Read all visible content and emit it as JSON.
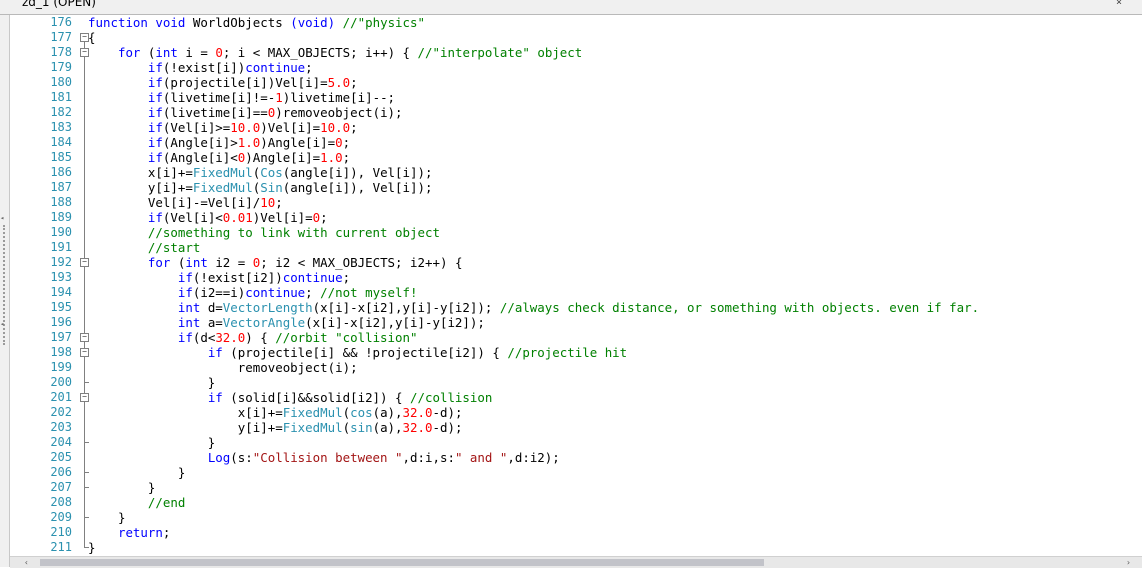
{
  "tab": {
    "title": "zd_1 (OPEN)",
    "close_label": "×"
  },
  "editor": {
    "lines": [
      {
        "num": "176",
        "fold": "none",
        "tokens": [
          {
            "t": "function void",
            "c": "kw"
          },
          {
            "t": " WorldObjects ",
            "c": ""
          },
          {
            "t": "(void)",
            "c": "kw"
          },
          {
            "t": " ",
            "c": ""
          },
          {
            "t": "//\"physics\"",
            "c": "cm"
          }
        ]
      },
      {
        "num": "177",
        "fold": "open",
        "tokens": [
          {
            "t": "{",
            "c": ""
          }
        ]
      },
      {
        "num": "178",
        "fold": "open",
        "tokens": [
          {
            "t": "    ",
            "c": ""
          },
          {
            "t": "for",
            "c": "kw"
          },
          {
            "t": " (",
            "c": ""
          },
          {
            "t": "int",
            "c": "kw"
          },
          {
            "t": " i = ",
            "c": ""
          },
          {
            "t": "0",
            "c": "num"
          },
          {
            "t": "; i < MAX_OBJECTS; i++) { ",
            "c": ""
          },
          {
            "t": "//\"interpolate\" object",
            "c": "cm"
          }
        ]
      },
      {
        "num": "179",
        "fold": "line",
        "tokens": [
          {
            "t": "        ",
            "c": ""
          },
          {
            "t": "if",
            "c": "kw"
          },
          {
            "t": "(!exist[i])",
            "c": ""
          },
          {
            "t": "continue",
            "c": "kw"
          },
          {
            "t": ";",
            "c": ""
          }
        ]
      },
      {
        "num": "180",
        "fold": "line",
        "tokens": [
          {
            "t": "        ",
            "c": ""
          },
          {
            "t": "if",
            "c": "kw"
          },
          {
            "t": "(projectile[i])Vel[i]=",
            "c": ""
          },
          {
            "t": "5.0",
            "c": "num"
          },
          {
            "t": ";",
            "c": ""
          }
        ]
      },
      {
        "num": "181",
        "fold": "line",
        "tokens": [
          {
            "t": "        ",
            "c": ""
          },
          {
            "t": "if",
            "c": "kw"
          },
          {
            "t": "(livetime[i]!=-",
            "c": ""
          },
          {
            "t": "1",
            "c": "num"
          },
          {
            "t": ")livetime[i]--;",
            "c": ""
          }
        ]
      },
      {
        "num": "182",
        "fold": "line",
        "tokens": [
          {
            "t": "        ",
            "c": ""
          },
          {
            "t": "if",
            "c": "kw"
          },
          {
            "t": "(livetime[i]==",
            "c": ""
          },
          {
            "t": "0",
            "c": "num"
          },
          {
            "t": ")removeobject(i);",
            "c": ""
          }
        ]
      },
      {
        "num": "183",
        "fold": "line",
        "tokens": [
          {
            "t": "        ",
            "c": ""
          },
          {
            "t": "if",
            "c": "kw"
          },
          {
            "t": "(Vel[i]>=",
            "c": ""
          },
          {
            "t": "10.0",
            "c": "num"
          },
          {
            "t": ")Vel[i]=",
            "c": ""
          },
          {
            "t": "10.0",
            "c": "num"
          },
          {
            "t": ";",
            "c": ""
          }
        ]
      },
      {
        "num": "184",
        "fold": "line",
        "tokens": [
          {
            "t": "        ",
            "c": ""
          },
          {
            "t": "if",
            "c": "kw"
          },
          {
            "t": "(Angle[i]>",
            "c": ""
          },
          {
            "t": "1.0",
            "c": "num"
          },
          {
            "t": ")Angle[i]=",
            "c": ""
          },
          {
            "t": "0",
            "c": "num"
          },
          {
            "t": ";",
            "c": ""
          }
        ]
      },
      {
        "num": "185",
        "fold": "line",
        "tokens": [
          {
            "t": "        ",
            "c": ""
          },
          {
            "t": "if",
            "c": "kw"
          },
          {
            "t": "(Angle[i]<",
            "c": ""
          },
          {
            "t": "0",
            "c": "num"
          },
          {
            "t": ")Angle[i]=",
            "c": ""
          },
          {
            "t": "1.0",
            "c": "num"
          },
          {
            "t": ";",
            "c": ""
          }
        ]
      },
      {
        "num": "186",
        "fold": "line",
        "tokens": [
          {
            "t": "        x[i]+=",
            "c": ""
          },
          {
            "t": "FixedMul",
            "c": "fn"
          },
          {
            "t": "(",
            "c": ""
          },
          {
            "t": "Cos",
            "c": "fn"
          },
          {
            "t": "(angle[i]), Vel[i]);",
            "c": ""
          }
        ]
      },
      {
        "num": "187",
        "fold": "line",
        "tokens": [
          {
            "t": "        y[i]+=",
            "c": ""
          },
          {
            "t": "FixedMul",
            "c": "fn"
          },
          {
            "t": "(",
            "c": ""
          },
          {
            "t": "Sin",
            "c": "fn"
          },
          {
            "t": "(angle[i]), Vel[i]);",
            "c": ""
          }
        ]
      },
      {
        "num": "188",
        "fold": "line",
        "tokens": [
          {
            "t": "        Vel[i]-=Vel[i]/",
            "c": ""
          },
          {
            "t": "10",
            "c": "num"
          },
          {
            "t": ";",
            "c": ""
          }
        ]
      },
      {
        "num": "189",
        "fold": "line",
        "tokens": [
          {
            "t": "        ",
            "c": ""
          },
          {
            "t": "if",
            "c": "kw"
          },
          {
            "t": "(Vel[i]<",
            "c": ""
          },
          {
            "t": "0.01",
            "c": "num"
          },
          {
            "t": ")Vel[i]=",
            "c": ""
          },
          {
            "t": "0",
            "c": "num"
          },
          {
            "t": ";",
            "c": ""
          }
        ]
      },
      {
        "num": "190",
        "fold": "line",
        "tokens": [
          {
            "t": "        ",
            "c": ""
          },
          {
            "t": "//something to link with current object",
            "c": "cm"
          }
        ]
      },
      {
        "num": "191",
        "fold": "line",
        "tokens": [
          {
            "t": "        ",
            "c": ""
          },
          {
            "t": "//start",
            "c": "cm"
          }
        ]
      },
      {
        "num": "192",
        "fold": "open",
        "tokens": [
          {
            "t": "        ",
            "c": ""
          },
          {
            "t": "for",
            "c": "kw"
          },
          {
            "t": " (",
            "c": ""
          },
          {
            "t": "int",
            "c": "kw"
          },
          {
            "t": " i2 = ",
            "c": ""
          },
          {
            "t": "0",
            "c": "num"
          },
          {
            "t": "; i2 < MAX_OBJECTS; i2++) {",
            "c": ""
          }
        ]
      },
      {
        "num": "193",
        "fold": "line",
        "tokens": [
          {
            "t": "            ",
            "c": ""
          },
          {
            "t": "if",
            "c": "kw"
          },
          {
            "t": "(!exist[i2])",
            "c": ""
          },
          {
            "t": "continue",
            "c": "kw"
          },
          {
            "t": ";",
            "c": ""
          }
        ]
      },
      {
        "num": "194",
        "fold": "line",
        "tokens": [
          {
            "t": "            ",
            "c": ""
          },
          {
            "t": "if",
            "c": "kw"
          },
          {
            "t": "(i2==i)",
            "c": ""
          },
          {
            "t": "continue",
            "c": "kw"
          },
          {
            "t": "; ",
            "c": ""
          },
          {
            "t": "//not myself!",
            "c": "cm"
          }
        ]
      },
      {
        "num": "195",
        "fold": "line",
        "tokens": [
          {
            "t": "            ",
            "c": ""
          },
          {
            "t": "int",
            "c": "kw"
          },
          {
            "t": " d=",
            "c": ""
          },
          {
            "t": "VectorLength",
            "c": "fn"
          },
          {
            "t": "(x[i]-x[i2],y[i]-y[i2]); ",
            "c": ""
          },
          {
            "t": "//always check distance, or something with objects. even if far.",
            "c": "cm"
          }
        ]
      },
      {
        "num": "196",
        "fold": "line",
        "tokens": [
          {
            "t": "            ",
            "c": ""
          },
          {
            "t": "int",
            "c": "kw"
          },
          {
            "t": " a=",
            "c": ""
          },
          {
            "t": "VectorAngle",
            "c": "fn"
          },
          {
            "t": "(x[i]-x[i2],y[i]-y[i2]);",
            "c": ""
          }
        ]
      },
      {
        "num": "197",
        "fold": "open",
        "tokens": [
          {
            "t": "            ",
            "c": ""
          },
          {
            "t": "if",
            "c": "kw"
          },
          {
            "t": "(d<",
            "c": ""
          },
          {
            "t": "32.0",
            "c": "num"
          },
          {
            "t": ") { ",
            "c": ""
          },
          {
            "t": "//orbit \"collision\"",
            "c": "cm"
          }
        ]
      },
      {
        "num": "198",
        "fold": "open",
        "tokens": [
          {
            "t": "                ",
            "c": ""
          },
          {
            "t": "if",
            "c": "kw"
          },
          {
            "t": " (projectile[i] && !projectile[i2]) { ",
            "c": ""
          },
          {
            "t": "//projectile hit",
            "c": "cm"
          }
        ]
      },
      {
        "num": "199",
        "fold": "line",
        "tokens": [
          {
            "t": "                    removeobject(i);",
            "c": ""
          }
        ]
      },
      {
        "num": "200",
        "fold": "end",
        "tokens": [
          {
            "t": "                }",
            "c": ""
          }
        ]
      },
      {
        "num": "201",
        "fold": "open",
        "tokens": [
          {
            "t": "                ",
            "c": ""
          },
          {
            "t": "if",
            "c": "kw"
          },
          {
            "t": " (solid[i]&&solid[i2]) { ",
            "c": ""
          },
          {
            "t": "//collision",
            "c": "cm"
          }
        ]
      },
      {
        "num": "202",
        "fold": "line",
        "tokens": [
          {
            "t": "                    x[i]+=",
            "c": ""
          },
          {
            "t": "FixedMul",
            "c": "fn"
          },
          {
            "t": "(",
            "c": ""
          },
          {
            "t": "cos",
            "c": "fn"
          },
          {
            "t": "(a),",
            "c": ""
          },
          {
            "t": "32.0",
            "c": "num"
          },
          {
            "t": "-d);",
            "c": ""
          }
        ]
      },
      {
        "num": "203",
        "fold": "line",
        "tokens": [
          {
            "t": "                    y[i]+=",
            "c": ""
          },
          {
            "t": "FixedMul",
            "c": "fn"
          },
          {
            "t": "(",
            "c": ""
          },
          {
            "t": "sin",
            "c": "fn"
          },
          {
            "t": "(a),",
            "c": ""
          },
          {
            "t": "32.0",
            "c": "num"
          },
          {
            "t": "-d);",
            "c": ""
          }
        ]
      },
      {
        "num": "204",
        "fold": "end",
        "tokens": [
          {
            "t": "                }",
            "c": ""
          }
        ]
      },
      {
        "num": "205",
        "fold": "line",
        "tokens": [
          {
            "t": "                ",
            "c": ""
          },
          {
            "t": "Log",
            "c": "kw"
          },
          {
            "t": "(s:",
            "c": ""
          },
          {
            "t": "\"Collision between \"",
            "c": "str"
          },
          {
            "t": ",d:i,s:",
            "c": ""
          },
          {
            "t": "\" and \"",
            "c": "str"
          },
          {
            "t": ",d:i2);",
            "c": ""
          }
        ]
      },
      {
        "num": "206",
        "fold": "end",
        "tokens": [
          {
            "t": "            }",
            "c": ""
          }
        ]
      },
      {
        "num": "207",
        "fold": "end",
        "tokens": [
          {
            "t": "        }",
            "c": ""
          }
        ]
      },
      {
        "num": "208",
        "fold": "line",
        "tokens": [
          {
            "t": "        ",
            "c": ""
          },
          {
            "t": "//end",
            "c": "cm"
          }
        ]
      },
      {
        "num": "209",
        "fold": "end",
        "tokens": [
          {
            "t": "    }",
            "c": ""
          }
        ]
      },
      {
        "num": "210",
        "fold": "line",
        "tokens": [
          {
            "t": "    ",
            "c": ""
          },
          {
            "t": "return",
            "c": "kw"
          },
          {
            "t": ";",
            "c": ""
          }
        ]
      },
      {
        "num": "211",
        "fold": "last",
        "tokens": [
          {
            "t": "}",
            "c": ""
          }
        ]
      }
    ]
  },
  "scrollbar": {
    "left_arrow": "‹",
    "right_arrow": "›"
  },
  "colors": {
    "keyword": "#0000ff",
    "comment": "#008000",
    "string": "#a31515",
    "number": "#ff0000",
    "function": "#2b91af",
    "line_number": "#2b91af"
  }
}
